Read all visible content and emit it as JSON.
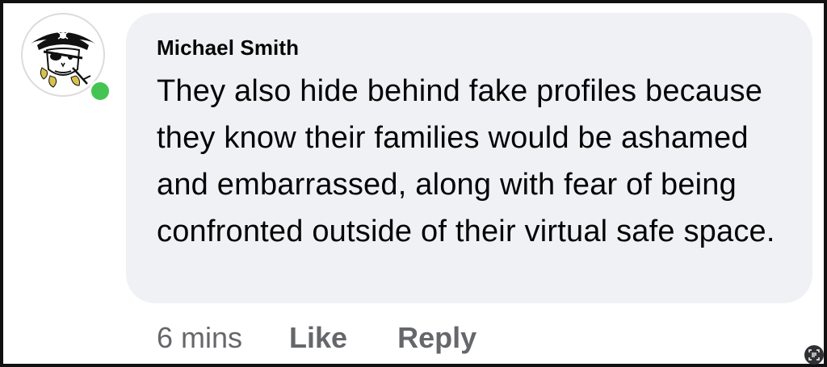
{
  "comment": {
    "author": "Michael Smith",
    "text": "They also hide behind fake profiles because they know their families would be ashamed and embarrassed, along with fear of being confronted outside of their virtual safe space.",
    "timestamp": "6 mins",
    "online_status_color": "#44c553",
    "avatar_icon": "pirate-skull-logo-icon"
  },
  "actions": {
    "like_label": "Like",
    "reply_label": "Reply"
  },
  "colors": {
    "bubble_background": "#f0f1f4",
    "text_primary": "#050505",
    "text_secondary": "#65676b"
  }
}
